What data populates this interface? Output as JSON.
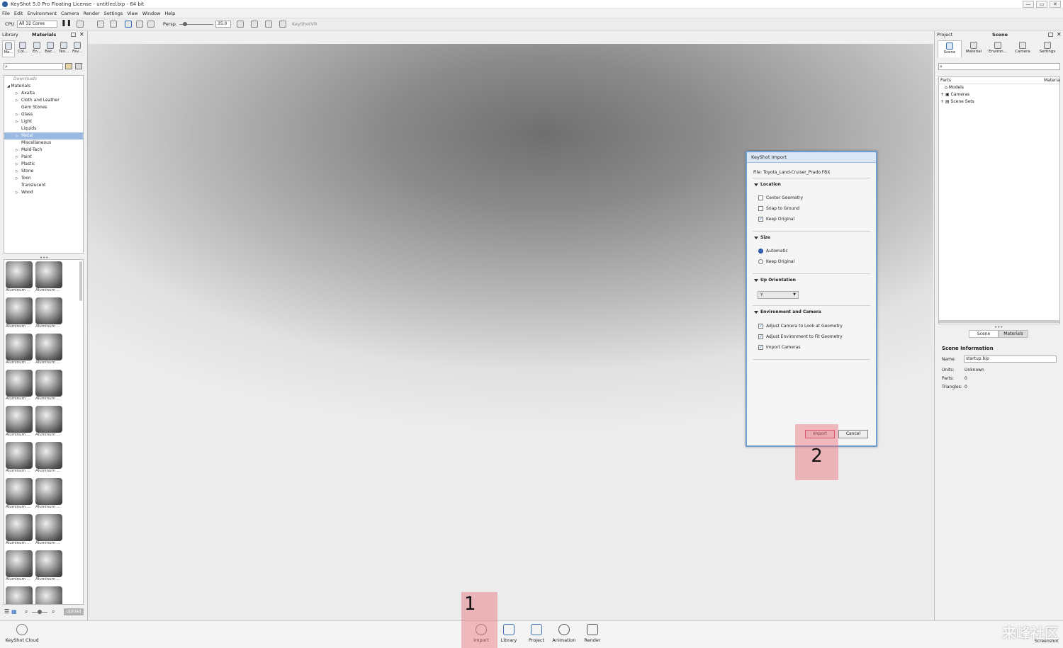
{
  "window": {
    "title": "KeyShot 5.0 Pro Floating License  - untitled.bip  - 64 bit",
    "controls": [
      "—",
      "▭",
      "✕"
    ]
  },
  "menu": [
    "File",
    "Edit",
    "Environment",
    "Camera",
    "Render",
    "Settings",
    "View",
    "Window",
    "Help"
  ],
  "toolbar": {
    "cpu_label": "CPU",
    "cores_value": "All 32 Cores",
    "persp_label": "Persp.",
    "fov_value": "35.0",
    "keyshotvr_label": "KeyShotVR"
  },
  "library": {
    "panel_title": "Library",
    "tab_title": "Materials",
    "tabs": [
      "Ma...",
      "Col...",
      "En...",
      "Bac...",
      "Tex...",
      "Fav..."
    ],
    "tree_root": "Downloads",
    "tree_header": "Materials",
    "tree_items": [
      "Axalta",
      "Cloth and Leather",
      "Gem Stones",
      "Glass",
      "Light",
      "Liquids",
      "Metal",
      "Miscellaneous",
      "Mold-Tech",
      "Paint",
      "Plastic",
      "Stone",
      "Toon",
      "Translucent",
      "Wood"
    ],
    "selected_item": "Metal",
    "thumb_label": "Aluminum ...",
    "upload_label": "Upload"
  },
  "project": {
    "panel_title": "Project",
    "tab_title": "Scene",
    "tabs": [
      "Scene",
      "Material",
      "Environ...",
      "Camera",
      "Settings"
    ],
    "parts_header": "Parts",
    "material_header": "Materia",
    "tree_items": [
      "Models",
      "Cameras",
      "Scene Sets"
    ],
    "sub_tabs": [
      "Scene",
      "Materials"
    ],
    "info_title": "Scene Information",
    "name_label": "Name:",
    "name_value": "startup.bip",
    "units_label": "Units:",
    "units_value": "Unknown",
    "parts_label": "Parts:",
    "parts_value": "0",
    "triangles_label": "Triangles:",
    "triangles_value": "0"
  },
  "dialog": {
    "title": "KeyShot Import",
    "file_label": "File: Toyota_Land-Cruiser_Prado.FBX",
    "location_title": "Location",
    "center_geometry": "Center Geometry",
    "snap_to_ground": "Snap to Ground",
    "keep_original": "Keep Original",
    "size_title": "Size",
    "automatic": "Automatic",
    "keep_original_size": "Keep Original",
    "up_orientation_title": "Up Orientation",
    "up_value": "Y",
    "env_camera_title": "Environment and Camera",
    "adjust_camera": "Adjust Camera to Look at Geometry",
    "adjust_env": "Adjust Environment to Fit Geometry",
    "import_cameras": "Import Cameras",
    "import_button": "Import",
    "cancel_button": "Cancel"
  },
  "highlights": {
    "one": "1",
    "two": "2"
  },
  "bottombar": {
    "cloud": "KeyShot Cloud",
    "import": "Import",
    "library": "Library",
    "project": "Project",
    "animation": "Animation",
    "render": "Render",
    "screenshot": "Screenshot"
  },
  "watermark": "来峰社区"
}
